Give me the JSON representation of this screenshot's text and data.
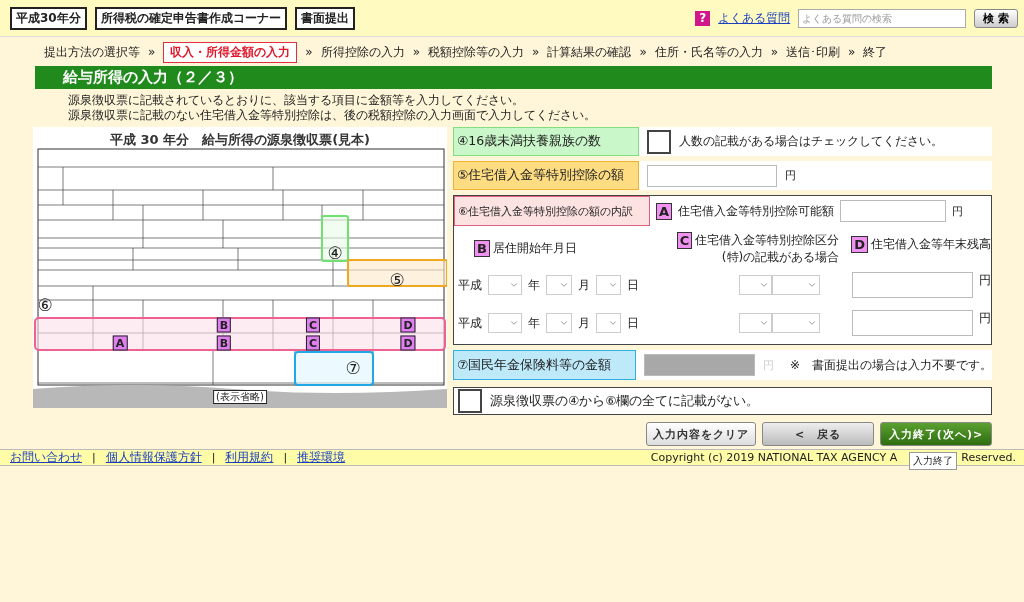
{
  "header": {
    "badges": [
      "平成30年分",
      "所得税の確定申告書作成コーナー",
      "書面提出"
    ],
    "help_mark": "?",
    "faq_link": "よくある質問",
    "search": {
      "placeholder": "よくある質問の検索"
    },
    "search_button": "検 索"
  },
  "steps": [
    {
      "kind": "step",
      "label": "提出方法の選択等",
      "selected": false
    },
    {
      "kind": "separator",
      "label": "»"
    },
    {
      "kind": "step",
      "label": "収入・所得金額の入力",
      "selected": true
    },
    {
      "kind": "separator",
      "label": "»"
    },
    {
      "kind": "step",
      "label": "所得控除の入力",
      "selected": false
    },
    {
      "kind": "separator",
      "label": "»"
    },
    {
      "kind": "step",
      "label": "税額控除等の入力",
      "selected": false
    },
    {
      "kind": "separator",
      "label": "»"
    },
    {
      "kind": "step",
      "label": "計算結果の確認",
      "selected": false
    },
    {
      "kind": "separator",
      "label": "»"
    },
    {
      "kind": "step",
      "label": "住所・氏名等の入力",
      "selected": false
    },
    {
      "kind": "separator",
      "label": "»"
    },
    {
      "kind": "step",
      "label": "送信･印刷",
      "selected": false
    },
    {
      "kind": "separator",
      "label": "»"
    },
    {
      "kind": "step",
      "label": "終了",
      "selected": false
    }
  ],
  "section_title": "給与所得の入力（２／３）",
  "instructions": [
    "源泉徴収票に記載されているとおりに、該当する項目に金額等を入力してください。",
    "源泉徴収票に記載のない住宅借入金等特別控除は、後の税額控除の入力画面で入力してください。"
  ],
  "sample_form": {
    "title": "平成 30 年分　給与所得の源泉徴収票(見本)",
    "omitted": "(表示省略)",
    "markers": [
      "④",
      "⑤",
      "⑥",
      "⑦",
      "A",
      "B",
      "B",
      "C",
      "C",
      "D",
      "D"
    ]
  },
  "dependents": {
    "label": "④16歳未満扶養親族の数",
    "checked": false,
    "note": "人数の記載がある場合はチェックしてください。"
  },
  "housing_deduction": {
    "label": "⑤住宅借入金等特別控除の額",
    "unit": "円"
  },
  "housing_breakdown": {
    "label": "⑥住宅借入金等特別控除の額の内訳",
    "a": {
      "mark": "A",
      "label": "住宅借入金等特別控除可能額",
      "unit": "円"
    },
    "b": {
      "mark": "B",
      "label": "居住開始年月日"
    },
    "c": {
      "mark": "C",
      "label": "住宅借入金等特別控除区分",
      "note": "(特)の記載がある場合"
    },
    "d": {
      "mark": "D",
      "label": "住宅借入金等年末残高"
    },
    "rows": [
      {
        "era": "平成",
        "year_unit": "年",
        "month_unit": "月",
        "day_unit": "日",
        "amount_unit": "円"
      },
      {
        "era": "平成",
        "year_unit": "年",
        "month_unit": "月",
        "day_unit": "日",
        "amount_unit": "円"
      }
    ]
  },
  "pension": {
    "label": "⑦国民年金保険料等の金額",
    "disabled": true,
    "unit": "円",
    "note": "※　書面提出の場合は入力不要です。"
  },
  "none_listed": {
    "checked": false,
    "label": "源泉徴収票の④から⑥欄の全てに記載がない。"
  },
  "buttons": [
    {
      "kind": "plain",
      "label": "入力内容をクリア"
    },
    {
      "kind": "back",
      "label": "<　戻る"
    },
    {
      "kind": "primary",
      "label": "入力終了(次へ)>"
    }
  ],
  "tooltip": "入力終了",
  "footer": {
    "links": [
      {
        "kind": "link",
        "label": "お問い合わせ"
      },
      {
        "kind": "separator",
        "label": "|"
      },
      {
        "kind": "link",
        "label": "個人情報保護方針"
      },
      {
        "kind": "separator",
        "label": "|"
      },
      {
        "kind": "link",
        "label": "利用規約"
      },
      {
        "kind": "separator",
        "label": "|"
      },
      {
        "kind": "link",
        "label": "推奨環境"
      }
    ],
    "copyright_start": "Copyright (c) 2019 NATIONAL TAX AGENCY A",
    "copyright_end": "Reserved."
  }
}
